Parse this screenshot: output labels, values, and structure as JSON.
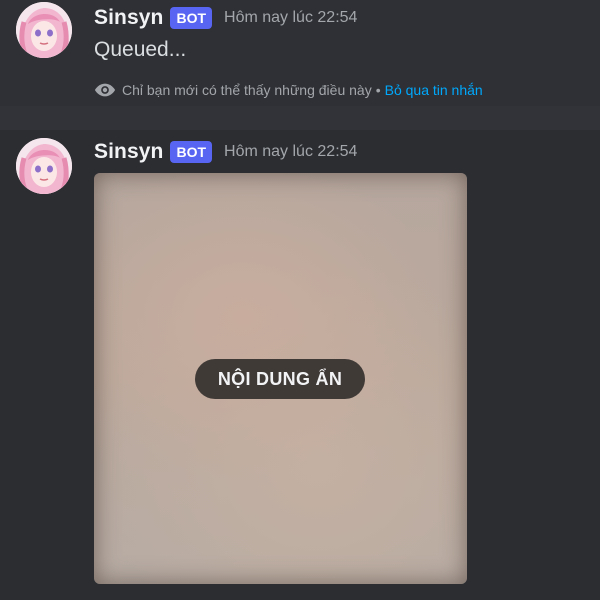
{
  "messages": [
    {
      "username": "Sinsyn",
      "bot_tag": "BOT",
      "timestamp": "Hôm nay lúc 22:54",
      "content": "Queued...",
      "ephemeral": {
        "icon": "eye-icon",
        "notice": "Chỉ bạn mới có thể thấy những điều này",
        "separator": "•",
        "dismiss_label": "Bỏ qua tin nhắn"
      }
    },
    {
      "username": "Sinsyn",
      "bot_tag": "BOT",
      "timestamp": "Hôm nay lúc 22:54",
      "attachment": {
        "spoiler_label": "NỘI DUNG ẨN"
      }
    }
  ],
  "colors": {
    "background": "#313338",
    "bot_tag": "#5865f2",
    "link": "#00a8fc",
    "username": "#f2f3f5",
    "timestamp": "#a3a6aa"
  }
}
